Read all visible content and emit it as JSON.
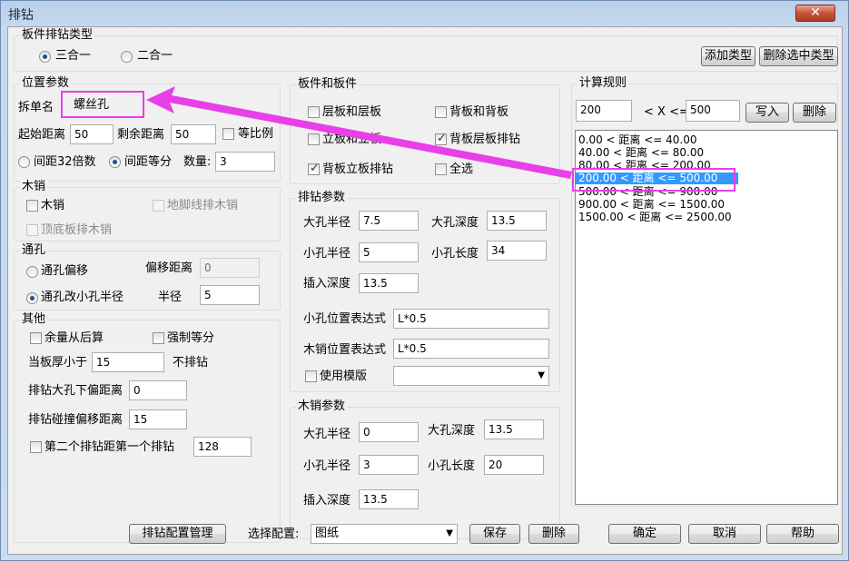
{
  "window": {
    "title": "排钻",
    "close": "✕"
  },
  "type_group": {
    "title": "板件排钻类型",
    "opt1": "三合一",
    "opt2": "二合一",
    "add_type": "添加类型",
    "del_type": "删除选中类型"
  },
  "pos": {
    "title": "位置参数",
    "split_label": "拆单名",
    "split_value": "螺丝孔",
    "start_label": "起始距离",
    "start_value": "50",
    "remain_label": "剩余距离",
    "remain_value": "50",
    "equal_ratio": "等比例",
    "spacing32": "间距32倍数",
    "spacing_equal": "间距等分",
    "count_label": "数量:",
    "count_value": "3"
  },
  "wood": {
    "title": "木销",
    "wood_pin": "木销",
    "foot_line": "地脚线排木销",
    "top_bottom": "顶底板排木销"
  },
  "through": {
    "title": "通孔",
    "offset_opt": "通孔偏移",
    "offset_label": "偏移距离",
    "offset_value": "0",
    "small_radius_opt": "通孔改小孔半径",
    "radius_label": "半径",
    "radius_value": "5"
  },
  "other": {
    "title": "其他",
    "remain_after": "余量从后算",
    "force_equal": "强制等分",
    "thick_label": "当板厚小于",
    "thick_value": "15",
    "no_drill": "不排钻",
    "big_down_label": "排钻大孔下偏距离",
    "big_down_value": "0",
    "collide_label": "排钻碰撞偏移距离",
    "collide_value": "15",
    "second_label": "第二个排钻距第一个排钻",
    "second_value": "128"
  },
  "boards": {
    "title": "板件和板件",
    "layer_layer": "层板和层板",
    "back_back": "背板和背板",
    "vert_vert": "立板和立板",
    "back_layer": "背板层板排钻",
    "back_vert": "背板立板排钻",
    "all": "全选"
  },
  "drill": {
    "title": "排钻参数",
    "big_r_label": "大孔半径",
    "big_r": "7.5",
    "big_d_label": "大孔深度",
    "big_d": "13.5",
    "small_r_label": "小孔半径",
    "small_r": "5",
    "small_l_label": "小孔长度",
    "small_l": "34",
    "insert_label": "插入深度",
    "insert": "13.5",
    "small_expr_label": "小孔位置表达式",
    "small_expr": "L*0.5",
    "wood_expr_label": "木销位置表达式",
    "wood_expr": "L*0.5",
    "template_label": "使用模版",
    "template_value": ""
  },
  "pin": {
    "title": "木销参数",
    "big_r_label": "大孔半径",
    "big_r": "0",
    "big_d_label": "大孔深度",
    "big_d": "13.5",
    "small_r_label": "小孔半径",
    "small_r": "3",
    "small_l_label": "小孔长度",
    "small_l": "20",
    "insert_label": "插入深度",
    "insert": "13.5"
  },
  "calc": {
    "title": "计算规则",
    "min": "200",
    "op": "< X <=",
    "max": "500",
    "write": "写入",
    "delete": "删除",
    "rules": [
      "0.00 < 距离 <= 40.00",
      "40.00 < 距离 <= 80.00",
      "80.00 < 距离 <= 200.00",
      "200.00 < 距离 <= 500.00",
      "500.00 < 距离 <= 900.00",
      "900.00 < 距离 <= 1500.00",
      "1500.00 < 距离 <= 2500.00"
    ]
  },
  "bottom": {
    "manage": "排钻配置管理",
    "select_label": "选择配置:",
    "config_value": "图纸",
    "save": "保存",
    "delete": "删除",
    "ok": "确定",
    "cancel": "取消",
    "help": "帮助"
  },
  "colors": {
    "highlight": "#e83fe8",
    "selection": "#3399ff"
  }
}
